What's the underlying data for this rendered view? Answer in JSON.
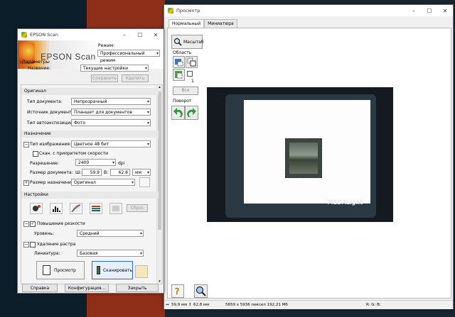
{
  "scan_window": {
    "title": "EPSON Scan",
    "logo_text": "EPSON Scan",
    "mode_label": "Режим:",
    "mode_value": "Профессиональный режим",
    "params_header": "Параметры",
    "name_label": "Название:",
    "name_value": "Текущие настройки",
    "save_btn": "Сохранить",
    "delete_btn": "Удалить",
    "original_header": "Оригинал",
    "doc_type_label": "Тип документа:",
    "doc_type_value": "Непрозрачный",
    "doc_source_label": "Источник документа:",
    "doc_source_value": "Планшет для документов",
    "autoexp_label": "Тип автоэкспозиции:",
    "autoexp_value": "Фото",
    "dest_header": "Назначение",
    "image_type_label": "Тип изображения:",
    "image_type_value": "Цветное 48 бит",
    "speed_label": "Скан. с приоритетом скорости",
    "resolution_label": "Разрешение:",
    "resolution_value": "2400",
    "dpi": "dpi",
    "doc_size_label": "Размер документа:",
    "w_label": "Ш:",
    "w_value": "59.9",
    "h_label": "В:",
    "h_value": "62.8",
    "unit_value": "мм",
    "target_size_label": "Размер назначения:",
    "target_size_value": "Оригинал",
    "settings_header": "Настройки",
    "reset_btn": "Сброс",
    "sharpen_label": "Повышение резкости",
    "level_label": "Уровень:",
    "level_value": "Средний",
    "descreen_label": "Удаление растра",
    "screen_label": "Линиатура:",
    "screen_value": "Базовая",
    "preview_btn": "Просмотр",
    "scan_btn": "Сканировать",
    "help_btn": "Справка",
    "config_btn": "Конфигурация...",
    "close_btn": "Закрыть"
  },
  "preview_window": {
    "title": "Просмотр",
    "tab_normal": "Нормальный",
    "tab_thumb": "Миниатюра",
    "zoom_btn": "Масштаб",
    "area_label": "Область",
    "area_count": "1",
    "all_btn": "Все",
    "rotate_label": "Поворот",
    "brand_text": "MEDALight",
    "status_size_w": "59,9 мм",
    "status_size_h": "62,8 мм",
    "status_pixels": "5659 x 5936 пиксел 192,21 Мб",
    "status_rgb": "R: G: B:"
  }
}
